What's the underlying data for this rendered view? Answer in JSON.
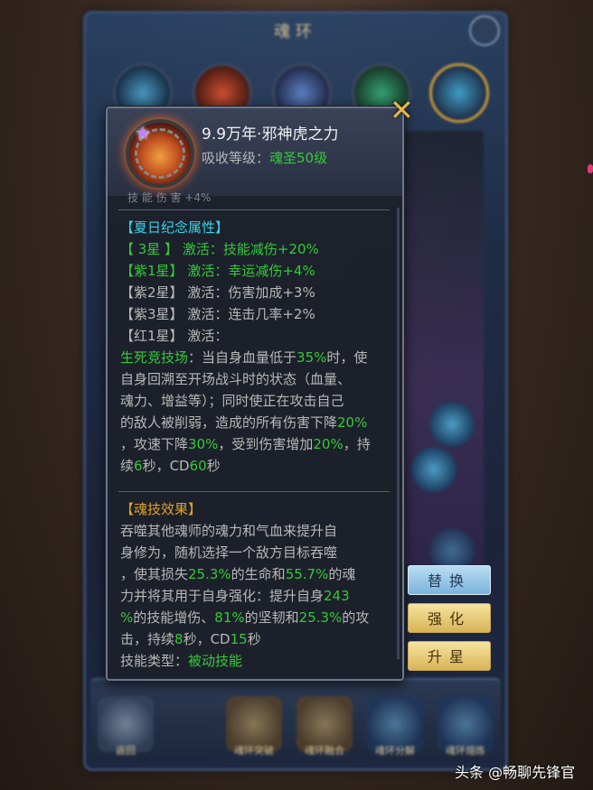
{
  "background": {
    "main_title": "魂环",
    "bottom_labels": [
      "返回",
      "",
      "魂环突破",
      "魂环融合",
      "魂环分解",
      "魂环熔炼"
    ]
  },
  "popup": {
    "ring_name": "9.9万年·邪神虎之力",
    "absorb_label": "吸收等级：",
    "absorb_value": "魂圣50级",
    "cut_line": "技 能 伤 害  +4%",
    "summer": {
      "title": "【夏日纪念属性】",
      "lines": [
        {
          "grade": "【 3星 】",
          "label": "激活：",
          "effect": "技能减伤+20%",
          "color": "green"
        },
        {
          "grade": "【紫1星】",
          "label": "激活：",
          "effect": "幸运减伤+4%",
          "color": "green"
        },
        {
          "grade": "【紫2星】",
          "label": "激活：",
          "effect": "伤害加成+3%",
          "color": "gray"
        },
        {
          "grade": "【紫3星】",
          "label": "激活：",
          "effect": "连击几率+2%",
          "color": "gray"
        },
        {
          "grade": "【红1星】",
          "label": "激活：",
          "effect": "",
          "color": "gray"
        }
      ],
      "arena_name": "生死竞技场",
      "arena_line1_a": "：当自身血量低于",
      "arena_pct1": "35%",
      "arena_line1_b": "时，使",
      "arena_line2": "自身回溯至开场战斗时的状态（血量、",
      "arena_line3": "魂力、增益等）；同时使正在攻击自己",
      "arena_line4_a": "的敌人被削弱，造成的所有伤害下降",
      "arena_pct2": "20%",
      "arena_line5_a": "，攻速下降",
      "arena_pct3": "30%",
      "arena_line5_b": "，受到伤害增加",
      "arena_pct4": "20%",
      "arena_line5_c": "，持",
      "arena_line6_a": "续",
      "arena_num1": "6",
      "arena_line6_b": "秒，CD",
      "arena_num2": "60",
      "arena_line6_c": "秒"
    },
    "skill": {
      "title": "【魂技效果】",
      "line1": "吞噬其他魂师的魂力和气血来提升自",
      "line2": "身修为，随机选择一个敌方目标吞噬",
      "line3_a": "，使其损失",
      "pct1": "25.3%",
      "line3_b": "的生命和",
      "pct2": "55.7%",
      "line3_c": "的魂",
      "line4_a": "力并将其用于自身强化：提升自身",
      "pct3": "243",
      "line5_a": "%",
      "line5_b": "的技能增伤、",
      "pct4": "81%",
      "line5_c": "的坚韧和",
      "pct5": "25.3%",
      "line5_d": "的攻",
      "line6_a": "击，持续",
      "num1": "8",
      "line6_b": "秒，CD",
      "num2": "15",
      "line6_c": "秒",
      "type_label": "技能类型：",
      "type_value": "被动技能"
    }
  },
  "buttons": {
    "replace": "替换",
    "enhance": "强化",
    "upgrade": "升星"
  },
  "watermark": "头条 @畅聊先锋官",
  "colors": {
    "green": "#35c93a",
    "cyan": "#3ad0e6",
    "orange": "#e0a030",
    "gold": "#e5b948"
  }
}
